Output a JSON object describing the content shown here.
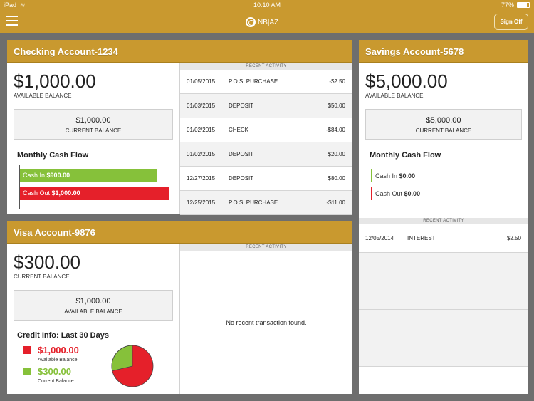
{
  "status_bar": {
    "device": "iPad",
    "time": "10:10 AM",
    "battery": "77%"
  },
  "app_bar": {
    "logo_text": "NB|AZ",
    "sign_off": "Sign Off"
  },
  "checking": {
    "title": "Checking Account-1234",
    "available_balance": "$1,000.00",
    "available_label": "AVAILABLE BALANCE",
    "current_balance": "$1,000.00",
    "current_label": "CURRENT BALANCE",
    "cash_flow_title": "Monthly Cash Flow",
    "cash_in_label": "Cash In",
    "cash_in_value": "$900.00",
    "cash_out_label": "Cash Out",
    "cash_out_value": "$1,000.00",
    "activity_header": "RECENT ACTIVITY",
    "activity": [
      {
        "date": "01/05/2015",
        "desc": "P.O.S. PURCHASE",
        "amount": "-$2.50"
      },
      {
        "date": "01/03/2015",
        "desc": "DEPOSIT",
        "amount": "$50.00"
      },
      {
        "date": "01/02/2015",
        "desc": "CHECK",
        "amount": "-$84.00"
      },
      {
        "date": "01/02/2015",
        "desc": "DEPOSIT",
        "amount": "$20.00"
      },
      {
        "date": "12/27/2015",
        "desc": "DEPOSIT",
        "amount": "$80.00"
      },
      {
        "date": "12/25/2015",
        "desc": "P.O.S. PURCHASE",
        "amount": "-$11.00"
      }
    ]
  },
  "visa": {
    "title": "Visa Account-9876",
    "current_balance": "$300.00",
    "current_label": "CURRENT BALANCE",
    "available_balance": "$1,000.00",
    "available_label": "AVAILABLE BALANCE",
    "credit_title": "Credit Info: Last 30 Days",
    "legend_available_value": "$1,000.00",
    "legend_available_label": "Available Balance",
    "legend_current_value": "$300.00",
    "legend_current_label": "Current Balance",
    "activity_header": "RECENT ACTIVITY",
    "no_activity": "No recent transaction found."
  },
  "savings": {
    "title": "Savings Account-5678",
    "available_balance": "$5,000.00",
    "available_label": "AVAILABLE BALANCE",
    "current_balance": "$5,000.00",
    "current_label": "CURRENT BALANCE",
    "cash_flow_title": "Monthly Cash Flow",
    "cash_in_label": "Cash In",
    "cash_in_value": "$0.00",
    "cash_out_label": "Cash Out",
    "cash_out_value": "$0.00",
    "activity_header": "RECENT ACTIVITY",
    "activity": [
      {
        "date": "12/05/2014",
        "desc": "INTEREST",
        "amount": "$2.50"
      }
    ]
  },
  "colors": {
    "brand_gold": "#c9992f",
    "cash_in_green": "#86c13a",
    "cash_out_red": "#e5202a"
  }
}
